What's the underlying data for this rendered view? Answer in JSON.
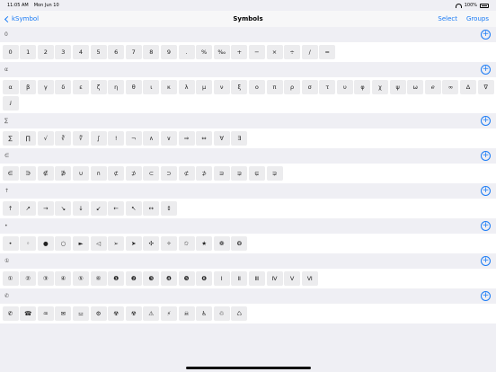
{
  "status": {
    "time": "11:05 AM",
    "date": "Mon Jun 10",
    "battery": "100%"
  },
  "nav": {
    "back_label": "kSymbol",
    "title": "Symbols",
    "select_label": "Select",
    "groups_label": "Groups"
  },
  "sections": [
    {
      "header": "0",
      "symbols": [
        "0",
        "1",
        "2",
        "3",
        "4",
        "5",
        "6",
        "7",
        "8",
        "9",
        ".",
        "%",
        "‰",
        "+",
        "−",
        "×",
        "÷",
        "/",
        "="
      ]
    },
    {
      "header": "α",
      "symbols": [
        "α",
        "β",
        "γ",
        "δ",
        "ε",
        "ζ",
        "η",
        "θ",
        "ι",
        "κ",
        "λ",
        "μ",
        "ν",
        "ξ",
        "ο",
        "π",
        "ρ",
        "σ",
        "τ",
        "υ",
        "φ",
        "χ",
        "ψ",
        "ω",
        "ℯ",
        "∞",
        "Δ",
        "∇",
        "ⅈ"
      ]
    },
    {
      "header": "∑",
      "symbols": [
        "∑",
        "∏",
        "√",
        "∛",
        "∜",
        "∫",
        "!",
        "¬",
        "∧",
        "∨",
        "⇒",
        "⇔",
        "∀",
        "∃"
      ]
    },
    {
      "header": "∈",
      "symbols": [
        "∈",
        "∋",
        "∉",
        "∌",
        "∪",
        "∩",
        "⊄",
        "⊅",
        "⊂",
        "⊃",
        "⊄",
        "⊅",
        "⊇",
        "⊋",
        "⊊",
        "⊋"
      ]
    },
    {
      "header": "↑",
      "symbols": [
        "↑",
        "↗",
        "→",
        "↘",
        "↓",
        "↙",
        "←",
        "↖",
        "↔",
        "↕"
      ]
    },
    {
      "header": "•",
      "symbols": [
        "•",
        "◦",
        "●",
        "○",
        "►",
        "◁",
        "➢",
        "➤",
        "✣",
        "✧",
        "✩",
        "★",
        "❁",
        "❂"
      ]
    },
    {
      "header": "①",
      "symbols": [
        "①",
        "②",
        "③",
        "④",
        "⑤",
        "⑥",
        "❶",
        "❷",
        "❸",
        "❹",
        "❺",
        "❻",
        "Ⅰ",
        "Ⅱ",
        "Ⅲ",
        "Ⅳ",
        "Ⅴ",
        "Ⅵ"
      ]
    },
    {
      "header": "✆",
      "symbols": [
        "✆",
        "☎",
        "♒",
        "✉",
        "⚍",
        "⚙",
        "☢",
        "☢",
        "⚠",
        "⚡",
        "☠",
        "♿",
        "♲",
        "♺"
      ]
    }
  ]
}
